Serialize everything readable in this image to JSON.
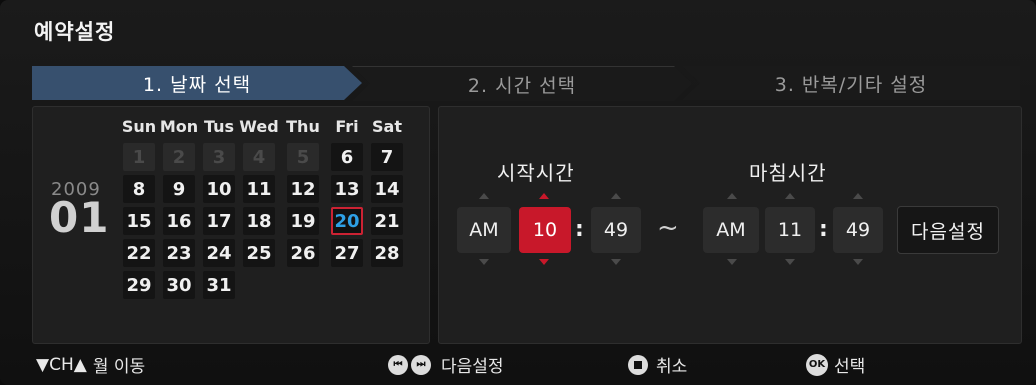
{
  "title": "예약설정",
  "steps": [
    {
      "label": "1. 날짜 선택",
      "active": true
    },
    {
      "label": "2. 시간 선택",
      "active": false
    },
    {
      "label": "3. 반복/기타 설정",
      "active": false
    }
  ],
  "calendar": {
    "year": "2009",
    "month": "01",
    "weekdays": [
      "Sun",
      "Mon",
      "Tus",
      "Wed",
      "Thu",
      "Fri",
      "Sat"
    ],
    "weeks": [
      [
        "1",
        "2",
        "3",
        "4",
        "5",
        "6",
        "7"
      ],
      [
        "8",
        "9",
        "10",
        "11",
        "12",
        "13",
        "14"
      ],
      [
        "15",
        "16",
        "17",
        "18",
        "19",
        "20",
        "21"
      ],
      [
        "22",
        "23",
        "24",
        "25",
        "26",
        "27",
        "28"
      ],
      [
        "29",
        "30",
        "31"
      ]
    ],
    "dimmed_days": [
      "1",
      "2",
      "3",
      "4",
      "5"
    ],
    "selected_day": "20"
  },
  "time": {
    "start_label": "시작시간",
    "end_label": "마침시간",
    "start": {
      "ampm": "AM",
      "hour": "10",
      "minute": "49"
    },
    "end": {
      "ampm": "AM",
      "hour": "11",
      "minute": "49"
    },
    "colon": ":",
    "separator": "~",
    "next_button": "다음설정"
  },
  "footer": {
    "ch_left": "▼CH▲",
    "ch_label": "월 이동",
    "next_label": "다음설정",
    "cancel_label": "취소",
    "ok_icon": "OK",
    "ok_label": "선택"
  },
  "colors": {
    "active_step": "#37506e",
    "selected_time": "#c8182a",
    "selected_day_text": "#2ea0e6",
    "selected_day_border": "#cc2233"
  }
}
